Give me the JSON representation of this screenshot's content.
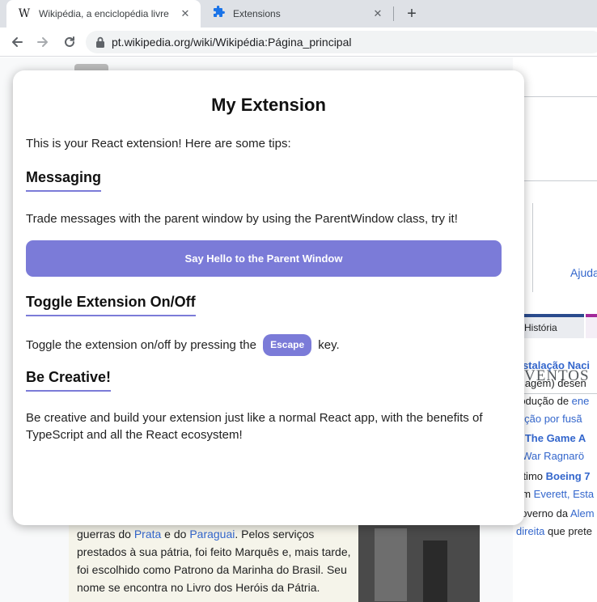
{
  "browser": {
    "tabs": [
      {
        "favicon": "W",
        "title": "Wikipédia, a enciclopédia livre",
        "active": true
      },
      {
        "favicon": "puzzle-icon",
        "title": "Extensions",
        "active": false
      }
    ],
    "new_tab": "+",
    "close_glyph": "✕",
    "url": "pt.wikipedia.org/wiki/Wikipédia:Página_principal"
  },
  "wiki": {
    "ajuda": "Ajuda",
    "historia_tab": "História",
    "eventos_heading": "VENTOS",
    "eventos_lines": [
      {
        "pre": "",
        "link": "nstalação Naci",
        "post": "",
        "bold": true
      },
      {
        "pre": "",
        "link": "",
        "post": "magem) desen",
        "bold": false
      },
      {
        "pre": "rodução de ",
        "link": "ene",
        "post": "",
        "bold": false
      },
      {
        "pre": "",
        "link": "nição por fusã",
        "post": "",
        "bold": false
      },
      {
        "pre": "o ",
        "link": "The Game A",
        "post": "",
        "bold": true
      },
      {
        "pre": "",
        "link": "f War Ragnarö",
        "post": "",
        "bold": false
      },
      {
        "pre": "• Último ",
        "link": "Boeing 7",
        "post": "",
        "bold": true
      },
      {
        "pre": "em ",
        "link": "Everett, Esta",
        "post": "",
        "bold": false
      },
      {
        "pre": "• Governo da ",
        "link": "Alem",
        "post": "",
        "bold": false
      },
      {
        "pre": "",
        "link": "direita",
        "post": " que prete",
        "bold": false
      }
    ],
    "paragraph": {
      "part1": "guerras do ",
      "link1": "Prata",
      "part2": " e do ",
      "link2": "Paraguai",
      "part3": ". Pelos serviços prestados à sua pátria, foi feito Marquês e, mais tarde, foi escolhido como Patrono da Marinha do Brasil. Seu nome se encontra no Livro dos Heróis da Pátria."
    }
  },
  "popup": {
    "title": "My Extension",
    "intro": "This is your React extension! Here are some tips:",
    "sections": {
      "messaging": {
        "heading": "Messaging",
        "text": "Trade messages with the parent window by using the ParentWindow class, try it!",
        "button": "Say Hello to the Parent Window"
      },
      "toggle": {
        "heading": "Toggle Extension On/Off",
        "text_before": "Toggle the extension on/off by pressing the",
        "key": "Escape",
        "text_after": "key."
      },
      "creative": {
        "heading": "Be Creative!",
        "text": "Be creative and build your extension just like a normal React app, with the benefits of TypeScript and all the React ecosystem!"
      }
    },
    "accent_color": "#7b7bd8"
  }
}
